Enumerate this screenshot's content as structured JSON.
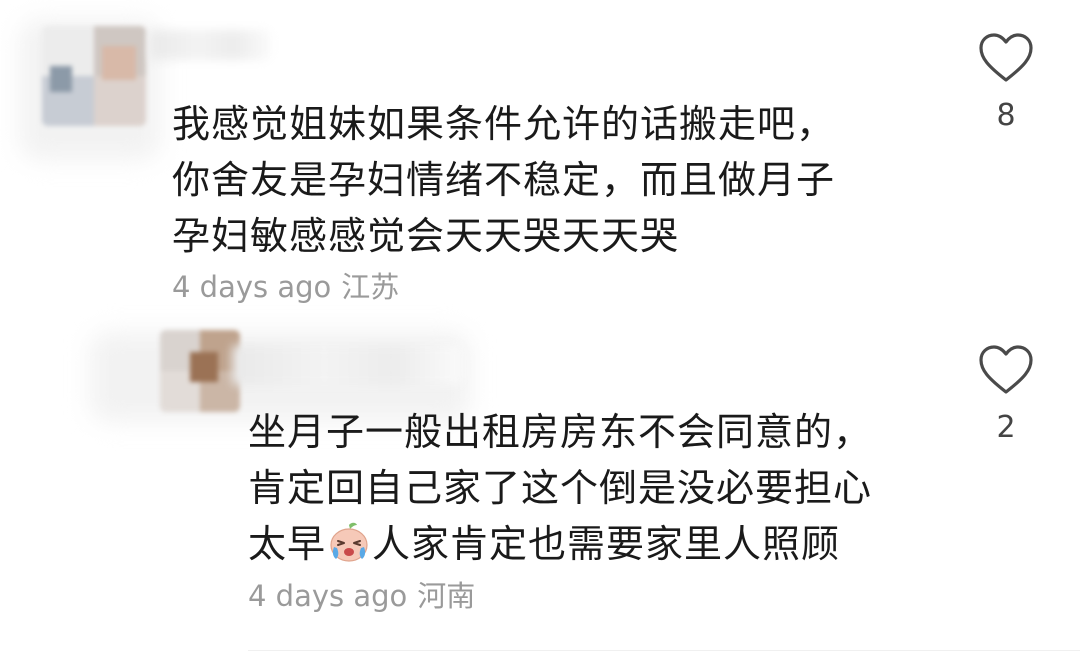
{
  "comments": [
    {
      "lines": [
        "我感觉姐妹如果条件允许的话搬走吧，",
        "你舍友是孕妇情绪不稳定，而且做月子",
        "孕妇敏感感觉会天天哭天天哭"
      ],
      "time": "4 days ago",
      "location": "江苏",
      "likes": "8",
      "heart_icon": "heart-outline-icon"
    },
    {
      "lines": [
        "坐月子一般出租房房东不会同意的，",
        "肯定回自己家了这个倒是没必要担心"
      ],
      "line3_before": "太早",
      "line3_emoji": "crying-face-emoji-icon",
      "line3_after": "人家肯定也需要家里人照顾",
      "time": "4 days ago",
      "location": "河南",
      "likes": "2",
      "heart_icon": "heart-outline-icon"
    }
  ],
  "colors": {
    "text": "#1a1a1a",
    "meta": "#9a9a9a",
    "icon": "#4a4a4a"
  }
}
